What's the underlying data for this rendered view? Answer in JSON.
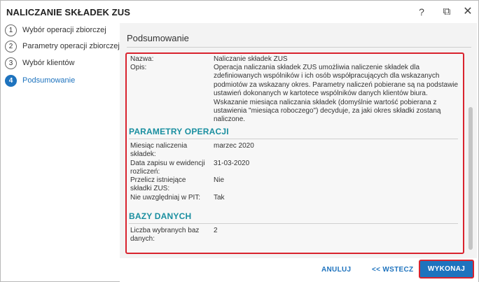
{
  "window": {
    "title": "NALICZANIE SKŁADEK ZUS"
  },
  "titlebar": {
    "help_glyph": "?",
    "restore_glyph": "⧉",
    "close_glyph": "✕"
  },
  "steps": [
    {
      "num": "1",
      "label": "Wybór operacji zbiorczej"
    },
    {
      "num": "2",
      "label": "Parametry operacji zbiorczej"
    },
    {
      "num": "3",
      "label": "Wybór klientów"
    },
    {
      "num": "4",
      "label": "Podsumowanie"
    }
  ],
  "summary": {
    "title": "Podsumowanie",
    "name_label": "Nazwa:",
    "name_value": "Naliczanie składek ZUS",
    "desc_label": "Opis:",
    "desc_value": "Operacja naliczania składek ZUS umożliwia naliczenie składek dla zdefiniowanych wspólników i ich osób współpracujących dla wskazanych podmiotów za wskazany okres. Parametry naliczeń pobierane są na podstawie ustawień dokonanych w kartotece wspólników danych klientów biura. Wskazanie miesiąca naliczania składek (domyślnie wartość pobierana z ustawienia \"miesiąca roboczego\") decyduje, za jaki okres składki zostaną naliczone."
  },
  "params": {
    "heading": "PARAMETRY OPERACJI",
    "rows": [
      {
        "label": "Miesiąc naliczenia składek:",
        "value": "marzec 2020"
      },
      {
        "label": "Data zapisu w ewidencji rozliczeń:",
        "value": "31-03-2020"
      },
      {
        "label": "Przelicz istniejące składki ZUS:",
        "value": "Nie"
      },
      {
        "label": "Nie uwzględniaj w PIT:",
        "value": "Tak"
      }
    ]
  },
  "databases": {
    "heading": "BAZY DANYCH",
    "rows": [
      {
        "label": "Liczba wybranych baz danych:",
        "value": "2"
      }
    ]
  },
  "footer": {
    "cancel_label": "ANULUJ",
    "back_label": "<< WSTECZ",
    "execute_label": "WYKONAJ"
  },
  "colors": {
    "accent": "#1e73be",
    "heading": "#1a8fa0",
    "highlight": "#d9232e"
  }
}
